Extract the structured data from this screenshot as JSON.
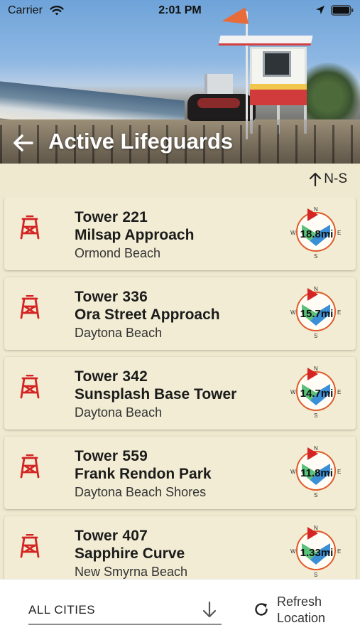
{
  "status_bar": {
    "carrier": "Carrier",
    "time": "2:01 PM",
    "icons": [
      "wifi-icon",
      "location-arrow-icon",
      "battery-icon"
    ]
  },
  "header": {
    "title": "Active Lifeguards",
    "back_icon": "back-arrow-icon"
  },
  "sort": {
    "label": "N-S",
    "icon": "arrow-up-icon"
  },
  "towers": [
    {
      "tower": "Tower 221",
      "location": "Milsap Approach",
      "city": "Ormond Beach",
      "distance": "18.8mi"
    },
    {
      "tower": "Tower 336",
      "location": "Ora Street Approach",
      "city": "Daytona Beach",
      "distance": "15.7mi"
    },
    {
      "tower": "Tower 342",
      "location": "Sunsplash Base Tower",
      "city": "Daytona Beach",
      "distance": "14.7mi"
    },
    {
      "tower": "Tower 559",
      "location": "Frank Rendon Park",
      "city": "Daytona Beach Shores",
      "distance": "11.8mi"
    },
    {
      "tower": "Tower 407",
      "location": "Sapphire Curve",
      "city": "New Smyrna Beach",
      "distance": "1.33mi"
    }
  ],
  "compass_labels": {
    "n": "N",
    "s": "S",
    "w": "W",
    "e": "E"
  },
  "bottom": {
    "city_filter": "ALL CITIES",
    "refresh_line1": "Refresh",
    "refresh_line2": "Location"
  },
  "colors": {
    "background": "#efe9cf",
    "card": "#f1ecd3",
    "tower_icon": "#d42424",
    "compass_ring": "#e05a2a"
  }
}
